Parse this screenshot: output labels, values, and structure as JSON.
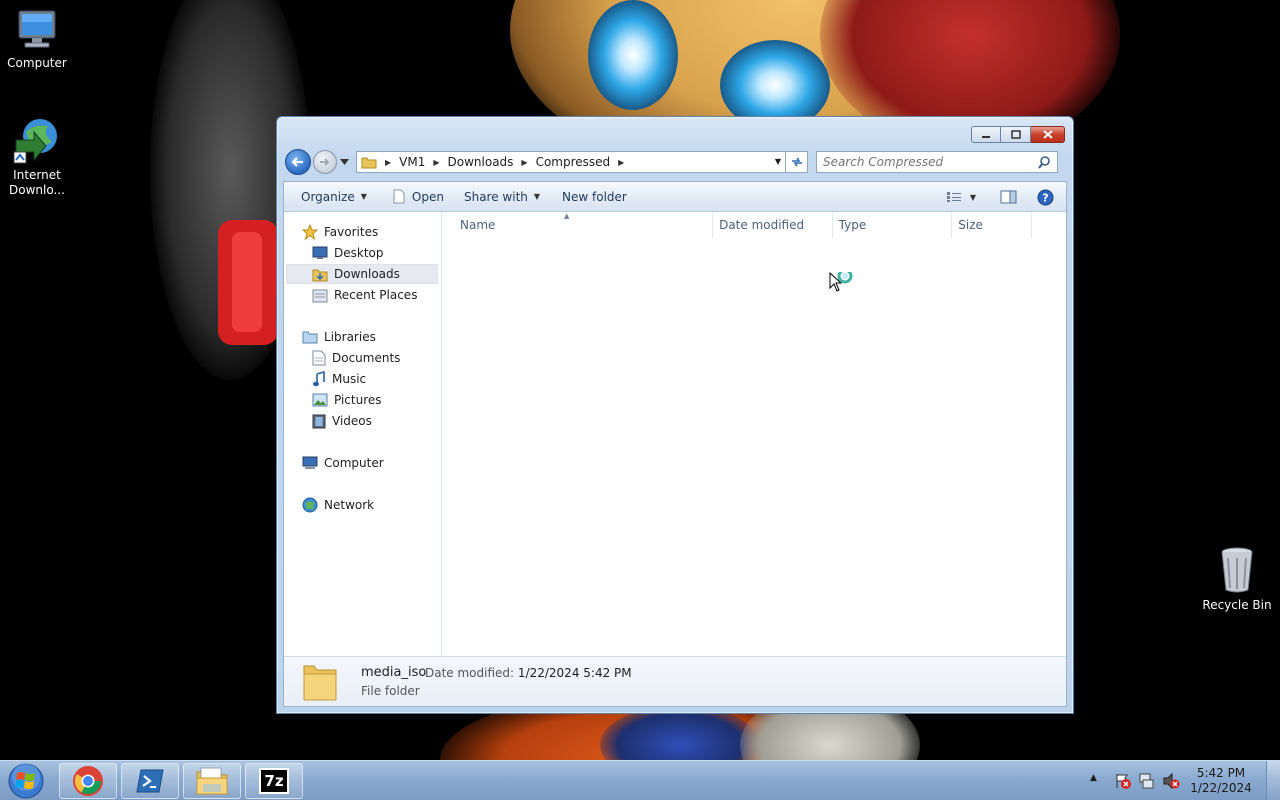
{
  "desktop": {
    "icons": [
      {
        "label": "Computer",
        "icon": "computer-icon"
      },
      {
        "label": "Internet\nDownlo...",
        "icon": "internet-download-manager-icon"
      },
      {
        "label": "Recycle Bin",
        "icon": "recycle-bin-icon"
      }
    ],
    "icon_labels": {
      "computer": "Computer",
      "idm_line1": "Internet",
      "idm_line2": "Downlo...",
      "recycle": "Recycle Bin"
    }
  },
  "window": {
    "breadcrumb": [
      "VM1",
      "Downloads",
      "Compressed"
    ],
    "search_placeholder": "Search Compressed",
    "toolbar": {
      "organize": "Organize",
      "open": "Open",
      "share_with": "Share with",
      "new_folder": "New folder"
    },
    "nav": {
      "favorites": "Favorites",
      "desktop": "Desktop",
      "downloads": "Downloads",
      "recent_places": "Recent Places",
      "libraries": "Libraries",
      "documents": "Documents",
      "music": "Music",
      "pictures": "Pictures",
      "videos": "Videos",
      "computer": "Computer",
      "network": "Network"
    },
    "columns": [
      "Name",
      "Date modified",
      "Type",
      "Size"
    ],
    "details": {
      "name": "media_iso",
      "modified_label": "Date modified:",
      "modified_value": "1/22/2024 5:42 PM",
      "type": "File folder"
    }
  },
  "taskbar": {
    "apps": [
      "chrome-icon",
      "powershell-icon",
      "explorer-icon",
      "7zip-icon"
    ],
    "app_label_7z": "7z",
    "time": "5:42 PM",
    "date": "1/22/2024"
  },
  "colors": {
    "accent": "#2a6bc4",
    "close_red": "#c8402a",
    "taskbar": "#8aaad0"
  }
}
